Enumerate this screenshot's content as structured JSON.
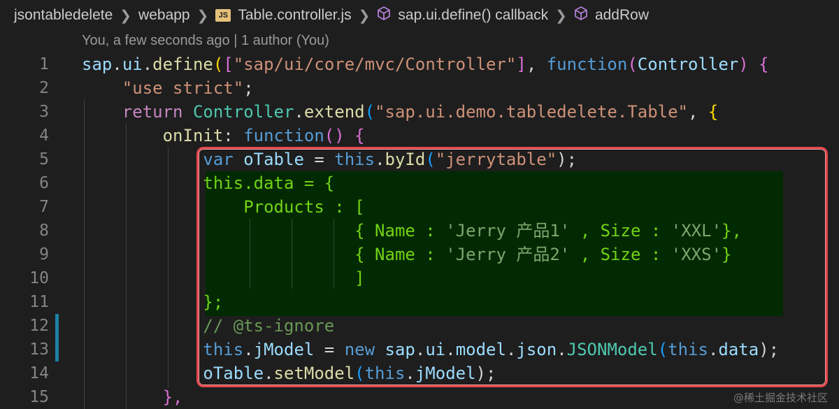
{
  "breadcrumb": {
    "items": [
      "jsontabledelete",
      "webapp",
      "Table.controller.js",
      "sap.ui.define() callback",
      "addRow"
    ],
    "js_badge": "JS"
  },
  "blame": "You, a few seconds ago | 1 author (You)",
  "line_numbers": [
    "1",
    "2",
    "3",
    "4",
    "5",
    "6",
    "7",
    "8",
    "9",
    "10",
    "11",
    "12",
    "13",
    "14",
    "15"
  ],
  "code": {
    "l1": [
      "sap",
      ".",
      "ui",
      ".",
      "define",
      "(",
      "[",
      "\"sap/ui/core/mvc/Controller\"",
      "]",
      ", ",
      "function",
      "(",
      "Controller",
      ")",
      " ",
      "{"
    ],
    "l2": [
      "\"use strict\"",
      ";"
    ],
    "l3": [
      "return",
      " ",
      "Controller",
      ".",
      "extend",
      "(",
      "\"sap.ui.demo.tabledelete.Table\"",
      ", ",
      "{"
    ],
    "l4": [
      "onInit",
      ": ",
      "function",
      "()",
      " ",
      "{"
    ],
    "l5": [
      "var",
      " ",
      "oTable",
      " = ",
      "this",
      ".",
      "byId",
      "(",
      "\"jerrytable\"",
      ");"
    ],
    "l6": [
      "this",
      ".",
      "data",
      " = ",
      "{"
    ],
    "l7": [
      "Products",
      " : ",
      "["
    ],
    "l8": [
      "{",
      " Name ",
      ": ",
      "'Jerry 产品1'",
      " , ",
      "Size",
      " : ",
      "'XXL'",
      "},"
    ],
    "l9": [
      "{",
      " Name ",
      ": ",
      "'Jerry 产品2'",
      " , ",
      "Size",
      " : ",
      "'XXS'",
      "}"
    ],
    "l10": [
      "]"
    ],
    "l11": [
      "};"
    ],
    "l12": [
      "// @ts-ignore"
    ],
    "l13": [
      "this",
      ".",
      "jModel",
      " = ",
      "new",
      " ",
      "sap",
      ".",
      "ui",
      ".",
      "model",
      ".",
      "json",
      ".",
      "JSONModel",
      "(",
      "this",
      ".",
      "data",
      ");"
    ],
    "l14": [
      "oTable",
      ".",
      "setModel",
      "(",
      "this",
      ".",
      "jModel",
      ");"
    ],
    "l15": [
      "},"
    ]
  },
  "watermark": "@稀土掘金技术社区",
  "colors": {
    "background": "#1e1e1e",
    "highlight_block": "#012a02",
    "red_box": "#e4474a",
    "git_bar": "#1b81a8"
  }
}
